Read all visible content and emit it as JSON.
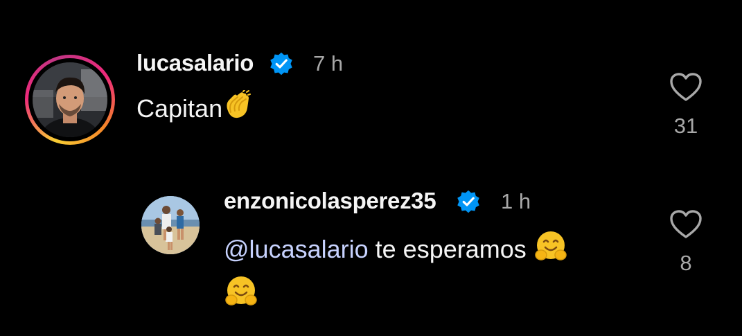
{
  "colors": {
    "background": "#000000",
    "text": "#f5f5f5",
    "muted": "#a8a8a8",
    "verified": "#0095f6",
    "mention": "#c7d2fe"
  },
  "comments": [
    {
      "username": "lucasalario",
      "verified_icon": "verified-badge-icon",
      "time": "7 h",
      "text": "Capitan",
      "emoji": "clapping-hands-emoji",
      "likes": "31",
      "like_icon": "heart-outline-icon"
    }
  ],
  "replies": [
    {
      "username": "enzonicolasperez35",
      "verified_icon": "verified-badge-icon",
      "time": "1 h",
      "mention": "@lucasalario",
      "text": "te esperamos",
      "emoji": "hugging-face-emoji",
      "likes": "8",
      "like_icon": "heart-outline-icon"
    }
  ]
}
